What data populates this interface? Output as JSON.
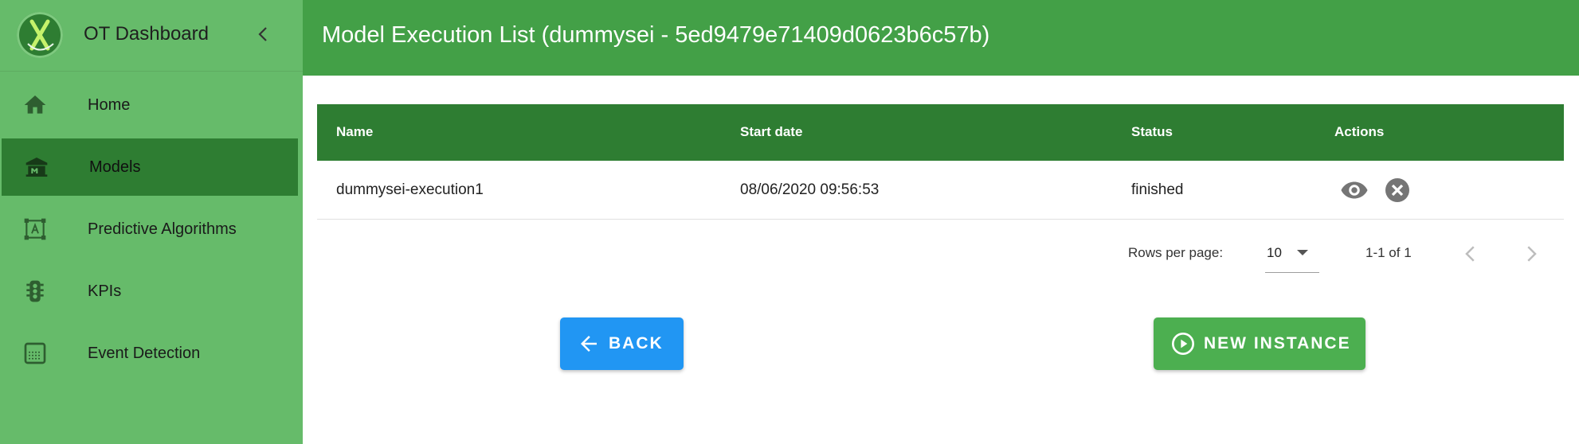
{
  "app": {
    "title": "OT Dashboard"
  },
  "sidebar": {
    "items": [
      {
        "label": "Home",
        "icon": "home-icon"
      },
      {
        "label": "Models",
        "icon": "museum-icon",
        "active": true
      },
      {
        "label": "Predictive Algorithms",
        "icon": "select-area-icon"
      },
      {
        "label": "KPIs",
        "icon": "traffic-light-icon"
      },
      {
        "label": "Event Detection",
        "icon": "texture-box-icon"
      }
    ]
  },
  "header": {
    "title": "Model Execution List (dummysei - 5ed9479e71409d0623b6c57b)"
  },
  "table": {
    "columns": [
      "Name",
      "Start date",
      "Status",
      "Actions"
    ],
    "rows": [
      {
        "name": "dummysei-execution1",
        "start_date": "08/06/2020 09:56:53",
        "status": "finished"
      }
    ]
  },
  "pagination": {
    "rows_label": "Rows per page:",
    "rows_value": "10",
    "range": "1-1 of 1"
  },
  "buttons": {
    "back": "BACK",
    "new_instance": "NEW INSTANCE"
  },
  "colors": {
    "sidebar": "#66bb6a",
    "active": "#2e7d32",
    "header": "#43a047",
    "back": "#2196f3",
    "new": "#4caf50"
  }
}
